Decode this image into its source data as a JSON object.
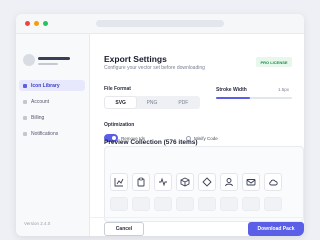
{
  "sidebar": {
    "items": [
      {
        "label": "Icon Library",
        "icon": "library-icon",
        "active": true
      },
      {
        "label": "Account",
        "icon": "account-icon",
        "active": false
      },
      {
        "label": "Billing",
        "icon": "billing-icon",
        "active": false
      },
      {
        "label": "Notifications",
        "icon": "notifications-icon",
        "active": false
      }
    ],
    "version": "Version 2.4.0"
  },
  "header": {
    "title": "Export Settings",
    "subtitle": "Configure your vector set before downloading",
    "badge": "PRO LICENSE"
  },
  "file_format": {
    "label": "File Format",
    "options": [
      "SVG",
      "PNG",
      "PDF"
    ],
    "selected": "SVG"
  },
  "stroke_width": {
    "label": "Stroke Width",
    "value": "1.5px",
    "level": 0.45
  },
  "optimization": {
    "label": "Optimization",
    "toggle_label": "Remove Ids",
    "toggle_on": true,
    "radio_label": "Minify Code"
  },
  "preview": {
    "title": "Preview Collection (576 items)",
    "icons": [
      "chart-icon",
      "clipboard-icon",
      "activity-icon",
      "cube-icon",
      "diamond-icon",
      "user-icon",
      "mail-icon",
      "cloud-icon"
    ]
  },
  "footer": {
    "cancel_label": "Cancel",
    "download_label": "Download Pack"
  },
  "colors": {
    "accent": "#5b5ee6",
    "badge_bg": "#e7f7ec",
    "badge_text": "#1f8a4c"
  }
}
